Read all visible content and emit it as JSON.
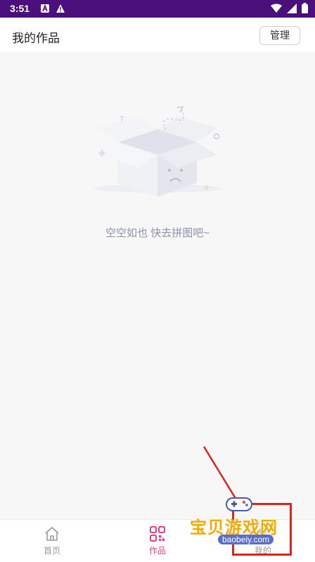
{
  "status_bar": {
    "time": "3:51"
  },
  "header": {
    "title": "我的作品",
    "manage_label": "管理"
  },
  "empty_state": {
    "message": "空空如也 快去拼图吧~"
  },
  "tabbar": {
    "items": [
      {
        "label": "首页",
        "icon": "home-icon",
        "active": false
      },
      {
        "label": "作品",
        "icon": "qr-grid-icon",
        "active": true
      },
      {
        "label": "我的",
        "icon": "user-icon",
        "active": false
      }
    ]
  },
  "watermark": {
    "brand": "宝贝游戏网",
    "url": "baobeiy.com"
  },
  "colors": {
    "status_bar": "#4a0f7a",
    "accent": "#e83f8c",
    "annotation_red": "#d9261c"
  }
}
